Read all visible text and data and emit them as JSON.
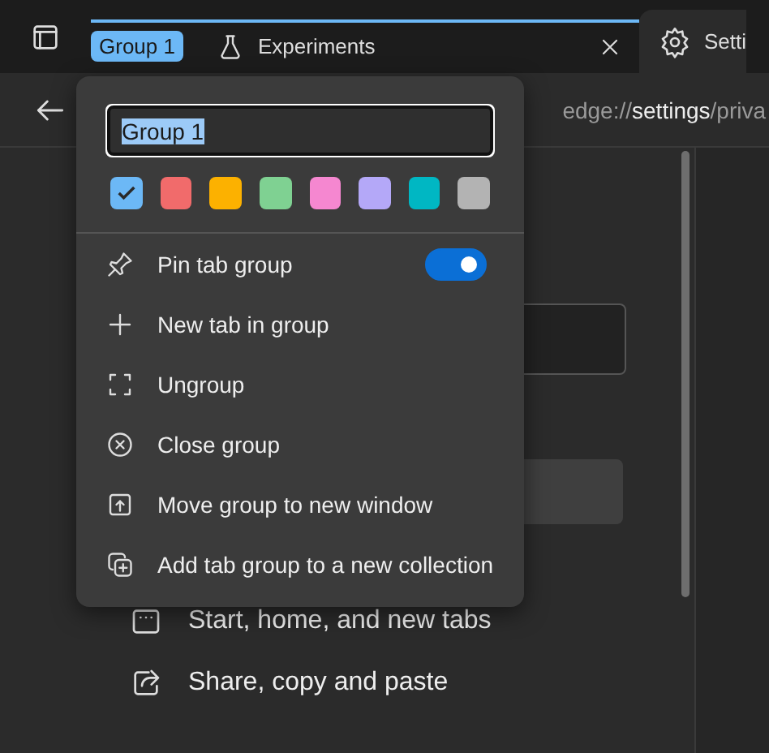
{
  "tab_strip": {
    "group": {
      "label": "Group 1",
      "color": "#6cb8f6"
    },
    "tabs": [
      {
        "label": "Experiments",
        "kind": "flask",
        "selected": false,
        "closable": true
      },
      {
        "label": "Setti",
        "kind": "gear",
        "selected": true,
        "closable": false
      }
    ]
  },
  "address_bar": {
    "prefix": "edge://",
    "host": "settings",
    "path": "/priva"
  },
  "settings_nav": [
    {
      "label": "Start, home, and new tabs",
      "kind": "home"
    },
    {
      "label": "Share, copy and paste",
      "kind": "share"
    }
  ],
  "group_menu": {
    "name_field": {
      "value": "Group 1"
    },
    "colors": [
      {
        "color": "#6cb8f6",
        "selected": true
      },
      {
        "color": "#f16b6b",
        "selected": false
      },
      {
        "color": "#fcb100",
        "selected": false
      },
      {
        "color": "#7fd192",
        "selected": false
      },
      {
        "color": "#f587d0",
        "selected": false
      },
      {
        "color": "#b4a8f8",
        "selected": false
      },
      {
        "color": "#00b7c3",
        "selected": false
      },
      {
        "color": "#b3b3b3",
        "selected": false
      }
    ],
    "items": [
      {
        "label": "Pin tab group",
        "kind": "pin",
        "toggle": true,
        "on": true
      },
      {
        "label": "New tab in group",
        "kind": "plus"
      },
      {
        "label": "Ungroup",
        "kind": "ungroup"
      },
      {
        "label": "Close group",
        "kind": "close"
      },
      {
        "label": "Move group to new window",
        "kind": "move"
      },
      {
        "label": "Add tab group to a new collection",
        "kind": "collection"
      }
    ]
  }
}
